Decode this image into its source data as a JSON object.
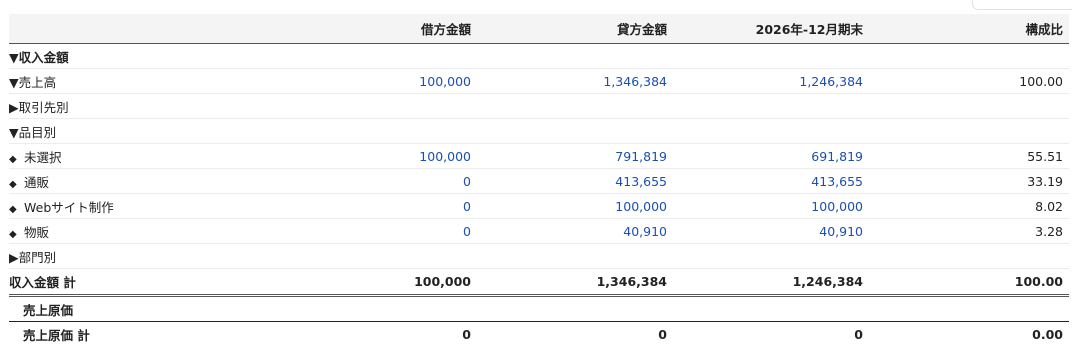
{
  "headers": {
    "name": "",
    "debit": "借方金額",
    "credit": "貸方金額",
    "period_end": "2026年-12月期末",
    "ratio": "構成比"
  },
  "income_section": {
    "label": "▼収入金額"
  },
  "sales": {
    "label": "▼売上高",
    "debit": "100,000",
    "credit": "1,346,384",
    "period_end": "1,246,384",
    "ratio": "100.00"
  },
  "by_partner": {
    "label": "▶取引先別"
  },
  "by_item": {
    "label": "▼品目別"
  },
  "items": [
    {
      "label": "未選択",
      "debit": "100,000",
      "credit": "791,819",
      "period_end": "691,819",
      "ratio": "55.51"
    },
    {
      "label": "通販",
      "debit": "0",
      "credit": "413,655",
      "period_end": "413,655",
      "ratio": "33.19"
    },
    {
      "label": "Webサイト制作",
      "debit": "0",
      "credit": "100,000",
      "period_end": "100,000",
      "ratio": "8.02"
    },
    {
      "label": "物販",
      "debit": "0",
      "credit": "40,910",
      "period_end": "40,910",
      "ratio": "3.28"
    }
  ],
  "by_department": {
    "label": "▶部門別"
  },
  "income_total": {
    "label": "収入金額 計",
    "debit": "100,000",
    "credit": "1,346,384",
    "period_end": "1,246,384",
    "ratio": "100.00"
  },
  "cost_section": {
    "label": "売上原価"
  },
  "cost_total": {
    "label": "売上原価 計",
    "debit": "0",
    "credit": "0",
    "period_end": "0",
    "ratio": "0.00"
  },
  "icons": {
    "tag": "tag-icon"
  },
  "colors": {
    "link": "#1a4fb3",
    "header_bg": "#f4f4f4"
  }
}
